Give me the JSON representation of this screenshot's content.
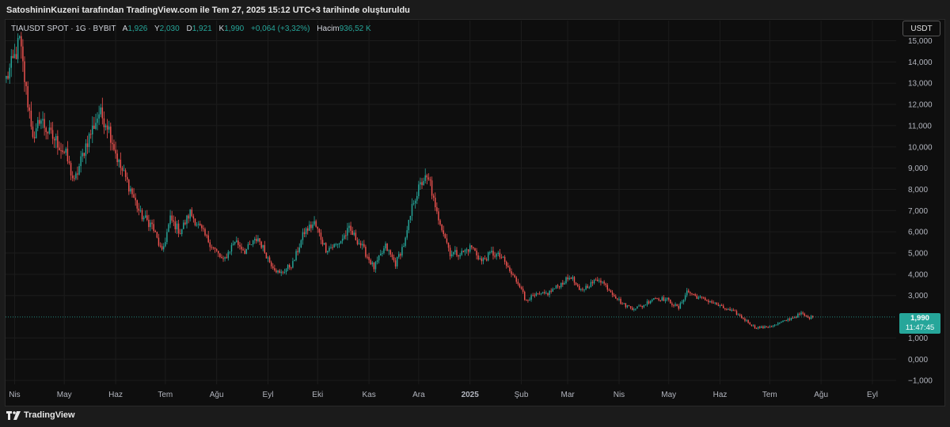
{
  "attribution": "SatoshininKuzeni tarafından TradingView.com ile Tem 27, 2025 15:12 UTC+3 tarihinde oluşturuldu",
  "legend": {
    "symbol": "TIAUSDT SPOT · 1G · BYBIT",
    "open_label": "A",
    "open": "1,926",
    "high_label": "Y",
    "high": "2,030",
    "low_label": "D",
    "low": "1,921",
    "close_label": "K",
    "close": "1,990",
    "change": "+0,064 (+3,32%)",
    "volume_label": "Hacim",
    "volume": "936,52 K"
  },
  "currency_button": "USDT",
  "last_price": {
    "value": "1,990",
    "countdown": "11:47:45"
  },
  "footer_brand": "TradingView",
  "colors": {
    "up": "#26a69a",
    "down": "#ef5350",
    "background": "#0e0e0e",
    "grid": "#1c1c1c"
  },
  "chart_data": {
    "type": "candlestick",
    "ylim": [
      -1,
      15.5
    ],
    "y_ticks": [
      {
        "v": 15,
        "label": "15,000"
      },
      {
        "v": 14,
        "label": "14,000"
      },
      {
        "v": 13,
        "label": "13,000"
      },
      {
        "v": 12,
        "label": "12,000"
      },
      {
        "v": 11,
        "label": "11,000"
      },
      {
        "v": 10,
        "label": "10,000"
      },
      {
        "v": 9,
        "label": "9,000"
      },
      {
        "v": 8,
        "label": "8,000"
      },
      {
        "v": 7,
        "label": "7,000"
      },
      {
        "v": 6,
        "label": "6,000"
      },
      {
        "v": 5,
        "label": "5,000"
      },
      {
        "v": 4,
        "label": "4,000"
      },
      {
        "v": 3,
        "label": "3,000"
      },
      {
        "v": 1,
        "label": "1,000"
      },
      {
        "v": 0,
        "label": "0,000"
      },
      {
        "v": -1,
        "label": "−1,000"
      }
    ],
    "x_ticks": [
      {
        "label": "Nis",
        "bold": false
      },
      {
        "label": "May",
        "bold": false
      },
      {
        "label": "Haz",
        "bold": false
      },
      {
        "label": "Tem",
        "bold": false
      },
      {
        "label": "Ağu",
        "bold": false
      },
      {
        "label": "Eyl",
        "bold": false
      },
      {
        "label": "Eki",
        "bold": false
      },
      {
        "label": "Kas",
        "bold": false
      },
      {
        "label": "Ara",
        "bold": false
      },
      {
        "label": "2025",
        "bold": true
      },
      {
        "label": "Şub",
        "bold": false
      },
      {
        "label": "Mar",
        "bold": false
      },
      {
        "label": "Nis",
        "bold": false
      },
      {
        "label": "May",
        "bold": false
      },
      {
        "label": "Haz",
        "bold": false
      },
      {
        "label": "Tem",
        "bold": false
      },
      {
        "label": "Ağu",
        "bold": false
      },
      {
        "label": "Eyl",
        "bold": false
      }
    ],
    "x_start": "2024-03-27",
    "x_end": "2025-09-12",
    "last_close": 1.99,
    "price_anchors": [
      [
        "2024-03-27",
        13.2
      ],
      [
        "2024-04-01",
        14.2
      ],
      [
        "2024-04-04",
        15.0
      ],
      [
        "2024-04-08",
        12.6
      ],
      [
        "2024-04-13",
        10.2
      ],
      [
        "2024-04-16",
        11.4
      ],
      [
        "2024-04-22",
        10.6
      ],
      [
        "2024-04-27",
        10.2
      ],
      [
        "2024-05-02",
        9.6
      ],
      [
        "2024-05-07",
        8.3
      ],
      [
        "2024-05-14",
        10.1
      ],
      [
        "2024-05-22",
        11.6
      ],
      [
        "2024-05-27",
        11.1
      ],
      [
        "2024-06-03",
        9.2
      ],
      [
        "2024-06-10",
        8.0
      ],
      [
        "2024-06-16",
        6.8
      ],
      [
        "2024-06-23",
        6.3
      ],
      [
        "2024-06-29",
        5.0
      ],
      [
        "2024-07-04",
        6.6
      ],
      [
        "2024-07-10",
        6.0
      ],
      [
        "2024-07-16",
        6.9
      ],
      [
        "2024-07-25",
        5.8
      ],
      [
        "2024-08-05",
        4.6
      ],
      [
        "2024-08-12",
        5.6
      ],
      [
        "2024-08-18",
        5.1
      ],
      [
        "2024-08-26",
        5.7
      ],
      [
        "2024-09-02",
        4.6
      ],
      [
        "2024-09-08",
        4.0
      ],
      [
        "2024-09-16",
        4.5
      ],
      [
        "2024-09-23",
        6.0
      ],
      [
        "2024-09-29",
        6.4
      ],
      [
        "2024-10-06",
        5.2
      ],
      [
        "2024-10-13",
        5.4
      ],
      [
        "2024-10-20",
        6.1
      ],
      [
        "2024-10-27",
        5.4
      ],
      [
        "2024-11-04",
        4.3
      ],
      [
        "2024-11-11",
        5.3
      ],
      [
        "2024-11-17",
        4.5
      ],
      [
        "2024-11-23",
        5.6
      ],
      [
        "2024-11-28",
        7.5
      ],
      [
        "2024-12-04",
        8.5
      ],
      [
        "2024-12-08",
        8.3
      ],
      [
        "2024-12-11",
        7.0
      ],
      [
        "2024-12-14",
        6.5
      ],
      [
        "2024-12-20",
        5.0
      ],
      [
        "2024-12-27",
        5.0
      ],
      [
        "2025-01-02",
        5.3
      ],
      [
        "2025-01-08",
        4.6
      ],
      [
        "2025-01-14",
        5.0
      ],
      [
        "2025-01-20",
        4.8
      ],
      [
        "2025-01-26",
        4.0
      ],
      [
        "2025-02-01",
        3.4
      ],
      [
        "2025-02-03",
        2.8
      ],
      [
        "2025-02-10",
        3.0
      ],
      [
        "2025-02-17",
        3.1
      ],
      [
        "2025-02-24",
        3.5
      ],
      [
        "2025-03-03",
        3.9
      ],
      [
        "2025-03-08",
        3.2
      ],
      [
        "2025-03-14",
        3.5
      ],
      [
        "2025-03-20",
        3.8
      ],
      [
        "2025-03-27",
        3.2
      ],
      [
        "2025-04-03",
        2.6
      ],
      [
        "2025-04-09",
        2.4
      ],
      [
        "2025-04-15",
        2.5
      ],
      [
        "2025-04-22",
        2.9
      ],
      [
        "2025-04-30",
        2.8
      ],
      [
        "2025-05-07",
        2.4
      ],
      [
        "2025-05-12",
        3.2
      ],
      [
        "2025-05-19",
        2.9
      ],
      [
        "2025-05-27",
        2.7
      ],
      [
        "2025-06-03",
        2.4
      ],
      [
        "2025-06-10",
        2.2
      ],
      [
        "2025-06-17",
        1.8
      ],
      [
        "2025-06-22",
        1.5
      ],
      [
        "2025-06-28",
        1.5
      ],
      [
        "2025-07-04",
        1.6
      ],
      [
        "2025-07-10",
        1.8
      ],
      [
        "2025-07-16",
        2.0
      ],
      [
        "2025-07-20",
        2.15
      ],
      [
        "2025-07-24",
        1.95
      ],
      [
        "2025-07-27",
        1.99
      ]
    ]
  }
}
